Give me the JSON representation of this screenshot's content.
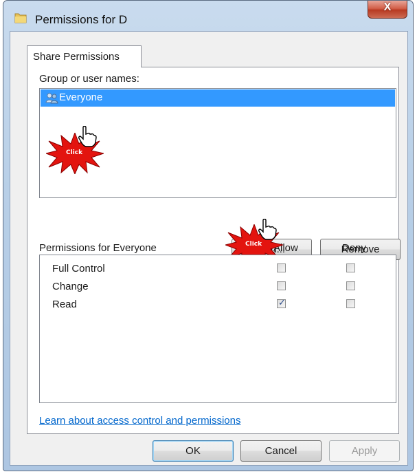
{
  "window": {
    "title": "Permissions for D",
    "close_glyph": "X"
  },
  "tabs": [
    {
      "label": "Share Permissions"
    }
  ],
  "group_section": {
    "label": "Group or user names:",
    "items": [
      {
        "name": "Everyone",
        "icon": "users-icon",
        "selected": true
      }
    ]
  },
  "buttons": {
    "add": "Add...",
    "remove": "Remove",
    "ok": "OK",
    "cancel": "Cancel",
    "apply": "Apply"
  },
  "permissions_section": {
    "label": "Permissions for Everyone",
    "columns": {
      "allow": "Allow",
      "deny": "Deny"
    },
    "rows": [
      {
        "name": "Full Control",
        "allow": false,
        "deny": false
      },
      {
        "name": "Change",
        "allow": false,
        "deny": false
      },
      {
        "name": "Read",
        "allow": true,
        "deny": false
      }
    ]
  },
  "link_text": "Learn about access control and permissions",
  "annotations": {
    "click_label": "Click",
    "burst_color": "#e3140f"
  },
  "colors": {
    "selection": "#3399ff",
    "link": "#0066cc"
  }
}
